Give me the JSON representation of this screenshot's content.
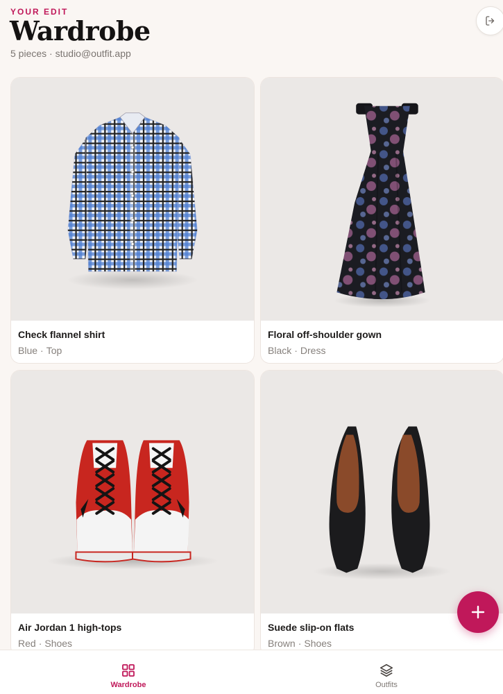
{
  "header": {
    "eyebrow": "YOUR EDIT",
    "title": "Wardrobe",
    "count": "5 pieces",
    "separator": "·",
    "account": "studio@outfit.app",
    "logout_icon": "logout-icon"
  },
  "items": [
    {
      "name": "Check flannel shirt",
      "color": "Blue",
      "category": "Top",
      "image": "plaid-shirt"
    },
    {
      "name": "Floral off-shoulder gown",
      "color": "Black",
      "category": "Dress",
      "image": "floral-gown"
    },
    {
      "name": "Air Jordan 1 high-tops",
      "color": "Red",
      "category": "Shoes",
      "image": "sneakers"
    },
    {
      "name": "Suede slip-on flats",
      "color": "Brown",
      "category": "Shoes",
      "image": "pumps"
    }
  ],
  "fab": {
    "icon": "plus-icon",
    "symbol": "+"
  },
  "tabs": [
    {
      "label": "Wardrobe",
      "icon": "grid-icon",
      "active": true
    },
    {
      "label": "Outfits",
      "icon": "layers-icon",
      "active": false
    }
  ],
  "colors": {
    "accent": "#c0185a",
    "background": "#faf6f3",
    "card": "#ffffff",
    "photo_bg": "#ebe8e6",
    "muted_text": "#86807c"
  }
}
